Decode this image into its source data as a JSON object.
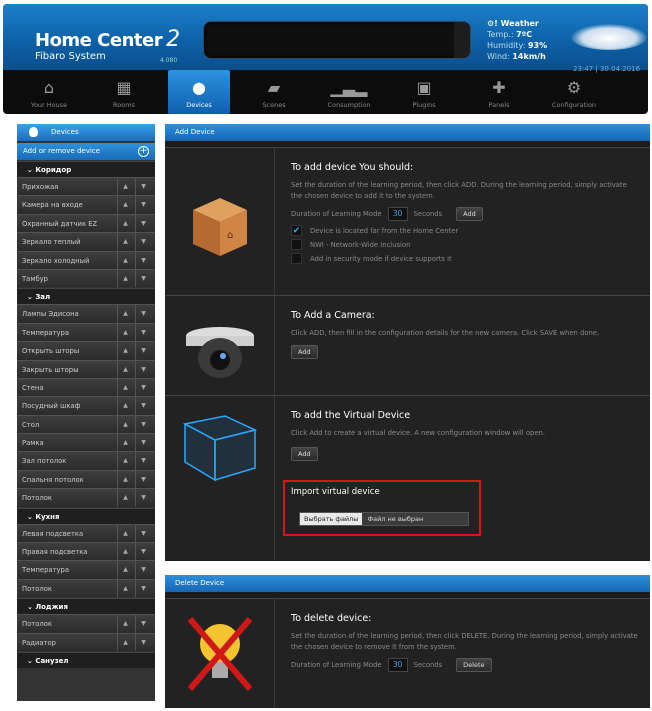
{
  "header": {
    "title": "Home Center",
    "title_num": "2",
    "subtitle": "Fibaro System",
    "version": "4.080",
    "weather": {
      "title": "Weather",
      "temp_label": "Temp.:",
      "temp": "7ºC",
      "hum_label": "Humidity:",
      "hum": "93%",
      "wind_label": "Wind:",
      "wind": "14km/h"
    },
    "datetime": "23:47 | 30.04.2016"
  },
  "nav": [
    {
      "label": "Your House",
      "icon": "house-icon"
    },
    {
      "label": "Rooms",
      "icon": "rooms-icon"
    },
    {
      "label": "Devices",
      "icon": "bulb-icon",
      "active": true
    },
    {
      "label": "Scenes",
      "icon": "scenes-icon"
    },
    {
      "label": "Consumption",
      "icon": "chart-icon"
    },
    {
      "label": "Plugins",
      "icon": "plugins-icon"
    },
    {
      "label": "Panels",
      "icon": "panels-icon"
    },
    {
      "label": "Configuration",
      "icon": "gears-icon"
    }
  ],
  "sidebar": {
    "title": "Devices",
    "add_label": "Add or remove device",
    "rooms": [
      {
        "name": "Коридор",
        "devices": [
          "Прихожая",
          "Камера на входе",
          "Охранный датчик EZ",
          "Зеркало теплый",
          "Зеркало холодный",
          "Тамбур"
        ]
      },
      {
        "name": "Зал",
        "devices": [
          "Лампы Эдисона",
          "Температура",
          "Открыть шторы",
          "Закрыть шторы",
          "Стена",
          "Посудный шкаф",
          "Стол",
          "Рамка",
          "Зал потолок",
          "Спальня потолок",
          "Потолок"
        ]
      },
      {
        "name": "Кухня",
        "devices": [
          "Левая подсветка",
          "Правая подсветка",
          "Температура",
          "Потолок"
        ]
      },
      {
        "name": "Лоджия",
        "devices": [
          "Потолок",
          "Радиатор"
        ]
      },
      {
        "name": "Санузел",
        "devices": []
      }
    ]
  },
  "add": {
    "header": "Add Device",
    "zwave": {
      "title": "To add device You should:",
      "desc": "Set the duration of the learning period, then click ADD. During the learning period, simply activate the chosen device to add it to the system.",
      "duration_label": "Duration of Learning Mode",
      "duration": "30",
      "unit": "Seconds",
      "button": "Add",
      "options": [
        {
          "label": "Device is located far from the Home Center",
          "checked": true
        },
        {
          "label": "NWI - Network-Wide Inclusion",
          "checked": false
        },
        {
          "label": "Add in security mode if device supports it",
          "checked": false
        }
      ]
    },
    "camera": {
      "title": "To Add a Camera:",
      "desc": "Click ADD, then fill in the configuration details for the new camera. Click SAVE when done.",
      "button": "Add"
    },
    "virtual": {
      "title": "To add the Virtual Device",
      "desc": "Click Add to create a virtual device. A new configuration window will open.",
      "button": "Add",
      "import_title": "Import virtual device",
      "file_button": "Выбрать файлы",
      "file_status": "Файл не выбран"
    }
  },
  "delete": {
    "header": "Delete Device",
    "title": "To delete device:",
    "desc": "Set the duration of the learning period, then click DELETE. During the learning period, simply activate the chosen device to remove it from the system.",
    "duration_label": "Duration of Learning Mode",
    "duration": "30",
    "unit": "Seconds",
    "button": "Delete"
  }
}
